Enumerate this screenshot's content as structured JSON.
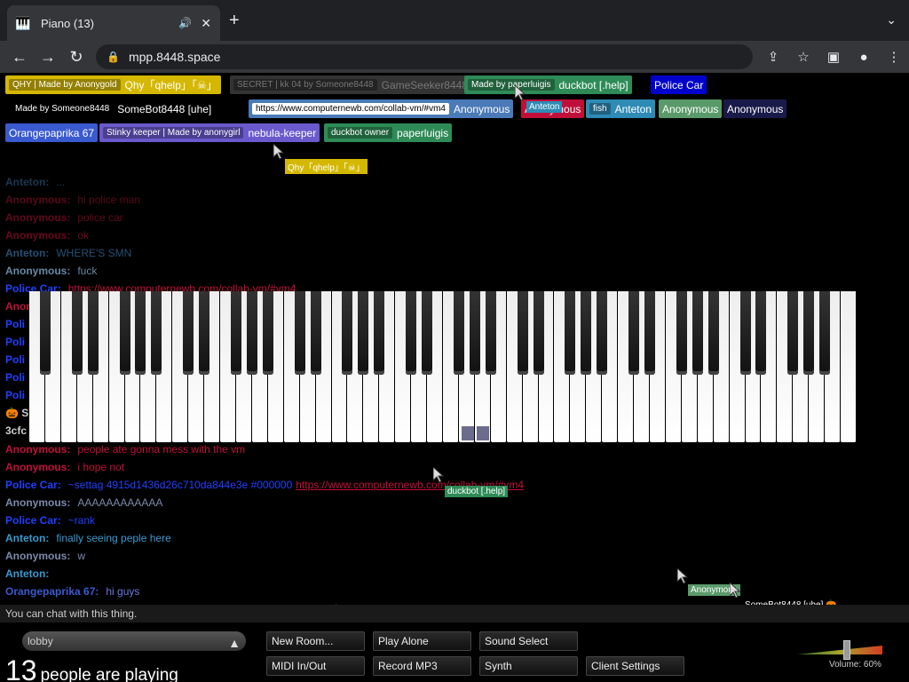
{
  "browser": {
    "tab_title": "Piano (13)",
    "url": "mpp.8448.space"
  },
  "players": [
    {
      "tag": "QHY | Made by Anonygold",
      "name": "Qhy「qhelp」「☠」",
      "color": "#d4b800"
    },
    {
      "tag": "SECRET | kk 04 by Someone8448",
      "name": "GameSeeker8448",
      "color": "#333333"
    },
    {
      "tag": "Made by paperluigis",
      "name": "duckbot [.help]",
      "color": "#2e8b57"
    },
    {
      "tag": "",
      "name": "Police Car",
      "color": "#0000cc"
    },
    {
      "tag": "Made by Someone8448",
      "name": "SomeBot8448 [uhe]",
      "color": "#000000"
    },
    {
      "tag": "https://www.computernewb.com/collab-vm/#vm4",
      "name": "Anonymous",
      "color": "#4a7ab8"
    },
    {
      "tag": "",
      "name": "Anonymous",
      "color": "#c0103a"
    },
    {
      "tag": "fish",
      "name": "Anteton",
      "color": "#2e8bb5"
    },
    {
      "tag": "",
      "name": "Anonymous",
      "color": "#5a9a6a"
    },
    {
      "tag": "",
      "name": "Anonymous",
      "color": "#1a1a4a"
    },
    {
      "tag": "",
      "name": "Orangepaprika 67",
      "color": "#3a5ad0"
    },
    {
      "tag": "Stinky keeper | Made by anonygirl",
      "name": "nebula-keeper",
      "color": "#6a5acd"
    },
    {
      "tag": "duckbot owner",
      "name": "paperluigis",
      "color": "#2e8b57"
    }
  ],
  "chat": [
    {
      "name": "Anteton:",
      "text": "...",
      "ncolor": "#3a7ab0",
      "tcolor": "#3a7ab0",
      "fade": 0.45
    },
    {
      "name": "Anonymous:",
      "text": "hi police man",
      "ncolor": "#c0103a",
      "tcolor": "#c0103a",
      "fade": 0.45
    },
    {
      "name": "Anonymous:",
      "text": "police car",
      "ncolor": "#c0103a",
      "tcolor": "#c0103a",
      "fade": 0.5
    },
    {
      "name": "Anonymous:",
      "text": "ok",
      "ncolor": "#c0103a",
      "tcolor": "#c0103a",
      "fade": 0.55
    },
    {
      "name": "Anteton:",
      "text": "WHERE'S SMN",
      "ncolor": "#3a7ab0",
      "tcolor": "#3a7ab0",
      "fade": 0.65
    },
    {
      "name": "Anonymous:",
      "text": "fuck",
      "ncolor": "#7aa0c0",
      "tcolor": "#7aa0c0",
      "fade": 0.85
    },
    {
      "name": "Police Car:",
      "text": "https://www.computernewb.com/collab-vm/#vm4",
      "ncolor": "#2040ff",
      "tcolor": "#c0103a",
      "fade": 1,
      "link": true
    }
  ],
  "chat_hidden_prefixes": [
    "Anon",
    "Poli",
    "Poli",
    "Poli",
    "Poli",
    "Poli",
    "🎃 S",
    "3cfc"
  ],
  "chat_lower": [
    {
      "name": "Anonymous:",
      "text": "people ate gonna mess with the vm",
      "ncolor": "#c0103a",
      "tcolor": "#c0103a"
    },
    {
      "name": "Anonymous:",
      "text": "i hope not",
      "ncolor": "#c0103a",
      "tcolor": "#c0103a"
    },
    {
      "name": "Police Car:",
      "text": "~settag 4915d1436d26c710da844e3e #000000",
      "link": "https://www.computernewb.com/collab-vm/#vm4",
      "ncolor": "#2040ff",
      "tcolor": "#2040ff"
    },
    {
      "name": "Anonymous:",
      "text": "AAAAAAAAAAAA",
      "ncolor": "#7a8aaa",
      "tcolor": "#7a8aaa"
    },
    {
      "name": "Police Car:",
      "text": "~rank",
      "ncolor": "#2040ff",
      "tcolor": "#2040ff"
    },
    {
      "name": "Anteton:",
      "text": "finally seeing peple here",
      "ncolor": "#3a9ad0",
      "tcolor": "#3a9ad0"
    },
    {
      "name": "Anonymous:",
      "text": "w",
      "ncolor": "#7a8aaa",
      "tcolor": "#7a8aaa"
    },
    {
      "name": "Anteton:",
      "text": "",
      "ncolor": "#3a9ad0",
      "tcolor": "#3a9ad0"
    },
    {
      "name": "Orangepaprika 67:",
      "text": "hi guys",
      "ncolor": "#3a5ad0",
      "tcolor": "#6a7ae0"
    }
  ],
  "cursor_labels": [
    {
      "name": "Anteton",
      "color": "#2e8bb5"
    },
    {
      "name": "Qhy「qhelp」「☠」",
      "color": "#d4b800"
    },
    {
      "name": "duckbot [.help]",
      "color": "#2e8b57"
    },
    {
      "name": "Anonymous",
      "color": "#5a9a6a"
    },
    {
      "name": "SomeBot8448 [uhe] 🎃",
      "color": "#000000"
    },
    {
      "name": "Orangepaprika 67",
      "color": "#3a5ad0"
    }
  ],
  "chat_input_placeholder": "You can chat with this thing.",
  "room": "lobby",
  "player_count": "13",
  "player_count_label": "people are playing",
  "buttons": {
    "new_room": "New Room...",
    "play_alone": "Play Alone",
    "sound_select": "Sound Select",
    "midi": "MIDI In/Out",
    "record": "Record MP3",
    "synth": "Synth",
    "client_settings": "Client Settings"
  },
  "volume": "Volume: 60%"
}
